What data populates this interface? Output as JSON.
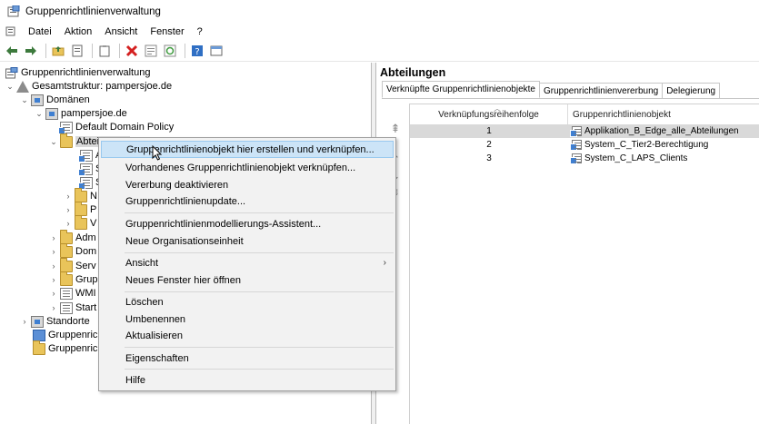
{
  "window": {
    "title": "Gruppenrichtlinienverwaltung"
  },
  "menu": [
    "Datei",
    "Aktion",
    "Ansicht",
    "Fenster",
    "?"
  ],
  "tree": {
    "root": "Gruppenrichtlinienverwaltung",
    "forest": "Gesamtstruktur: pampersjoe.de",
    "domains": "Domänen",
    "domain": "pampersjoe.de",
    "default_policy": "Default Domain Policy",
    "ou_selected": "Abteilungen",
    "ou_children_initials": [
      "A",
      "S",
      "S",
      "N",
      "P",
      "V"
    ],
    "siblings_partial": [
      "Adm",
      "Dom",
      "Serv",
      "Grup",
      "WMI",
      "Start"
    ],
    "standorte": "Standorte",
    "modeling": "Gruppenricht",
    "results": "Gruppenricht"
  },
  "right": {
    "title": "Abteilungen",
    "tabs": [
      "Verknüpfte Gruppenrichtlinienobjekte",
      "Gruppenrichtlinienvererbung",
      "Delegierung"
    ],
    "columns": {
      "order": "Verknüpfungsreihenfolge",
      "gpo": "Gruppenrichtlinienobjekt"
    },
    "rows": [
      {
        "order": "1",
        "gpo": "Applikation_B_Edge_alle_Abteilungen",
        "selected": true
      },
      {
        "order": "2",
        "gpo": "System_C_Tier2-Berechtigung",
        "selected": false
      },
      {
        "order": "3",
        "gpo": "System_C_LAPS_Clients",
        "selected": false
      }
    ]
  },
  "context_menu": {
    "items": [
      "Gruppenrichtlinienobjekt hier erstellen und verknüpfen...",
      "Vorhandenes Gruppenrichtlinienobjekt verknüpfen...",
      "Vererbung deaktivieren",
      "Gruppenrichtlinienupdate...",
      "Gruppenrichtlinienmodellierungs-Assistent...",
      "Neue Organisationseinheit",
      "Ansicht",
      "Neues Fenster hier öffnen",
      "Löschen",
      "Umbenennen",
      "Aktualisieren",
      "Eigenschaften",
      "Hilfe"
    ],
    "submenu_arrow": "›"
  },
  "colors": {
    "hover": "#cce4f7",
    "selected_row": "#d9d9d9",
    "folder": "#e9c45a"
  },
  "icons": {
    "toolbar": [
      "back-arrow-icon",
      "forward-arrow-icon",
      "folder-up-icon",
      "properties-icon",
      "clipboard-icon",
      "delete-icon",
      "export-icon",
      "refresh-icon",
      "help-icon",
      "console-icon"
    ]
  }
}
